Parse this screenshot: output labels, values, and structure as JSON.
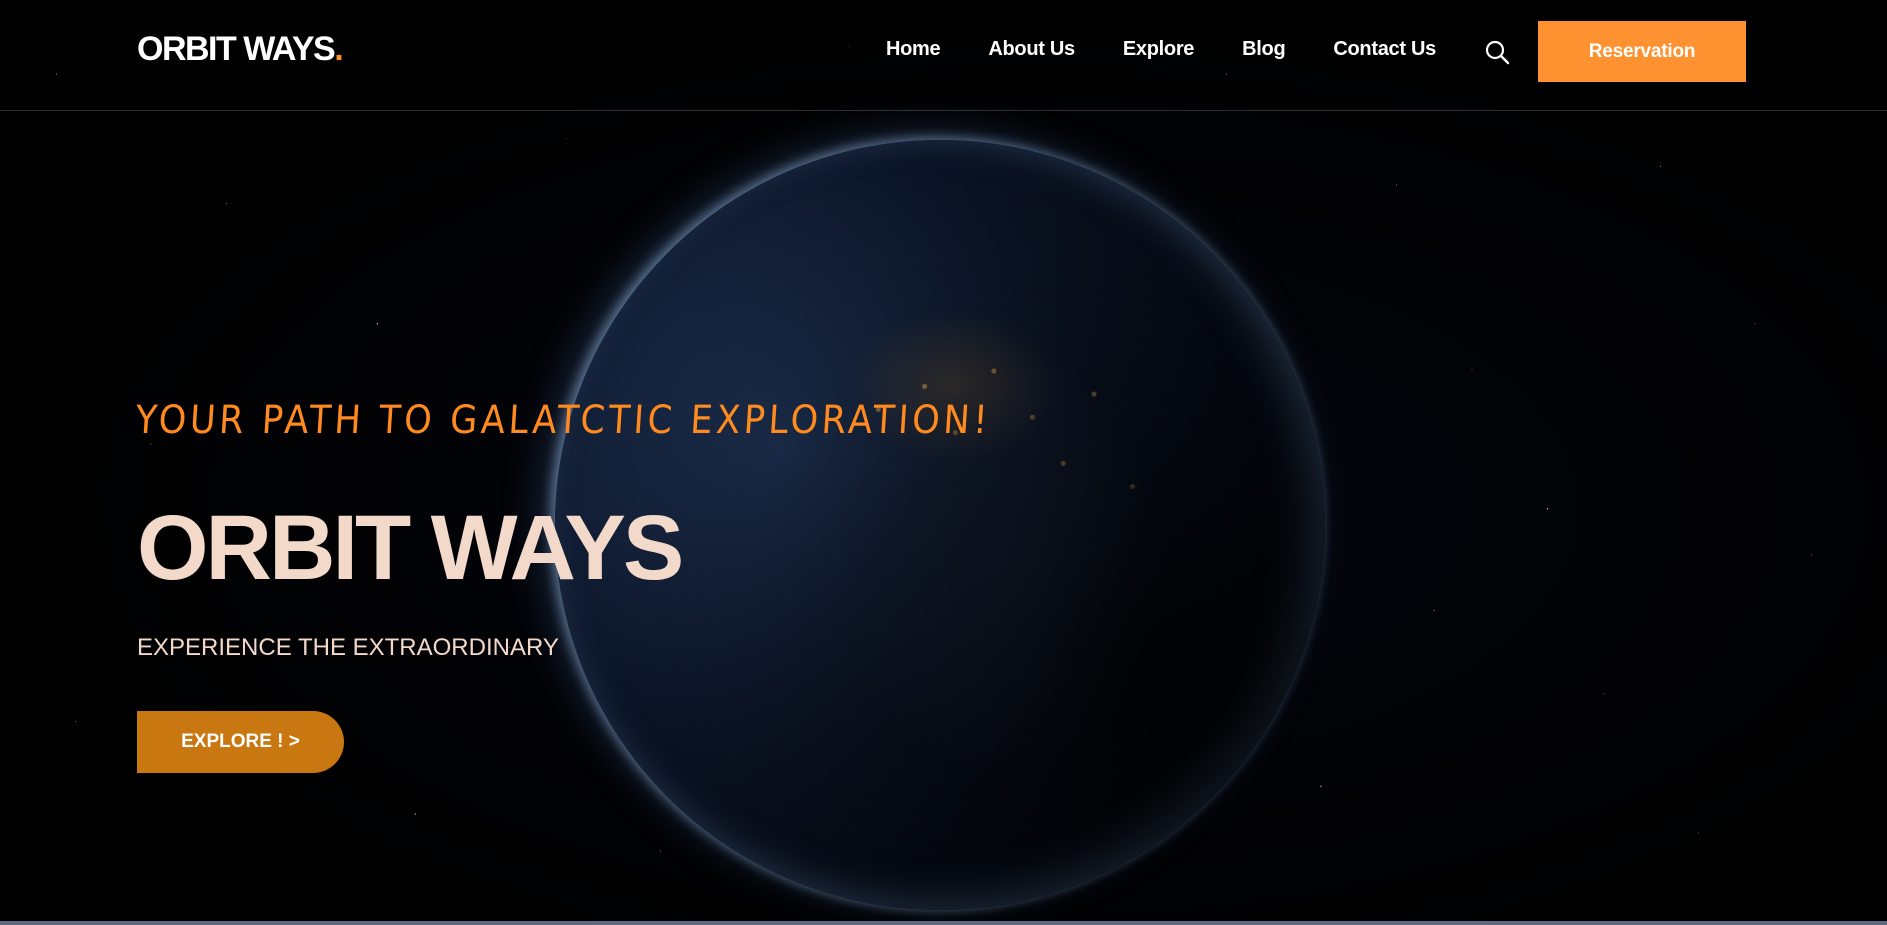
{
  "header": {
    "logo_text": "ORBIT WAYS",
    "logo_dot": ".",
    "nav": [
      {
        "label": "Home"
      },
      {
        "label": "About Us"
      },
      {
        "label": "Explore"
      },
      {
        "label": "Blog"
      },
      {
        "label": "Contact Us"
      }
    ],
    "search_icon": "search-icon",
    "reservation_label": "Reservation"
  },
  "hero": {
    "tagline": "YOUR PATH TO GALATCTIC EXPLORATION!",
    "title": "ORBIT WAYS",
    "subtitle": "EXPERIENCE THE EXTRAORDINARY",
    "cta_label": "EXPLORE ! >"
  },
  "colors": {
    "accent": "#ff9230",
    "cta": "#c97710",
    "title": "#f2d9c9",
    "tagline": "#ff8a1f",
    "background": "#000000"
  }
}
